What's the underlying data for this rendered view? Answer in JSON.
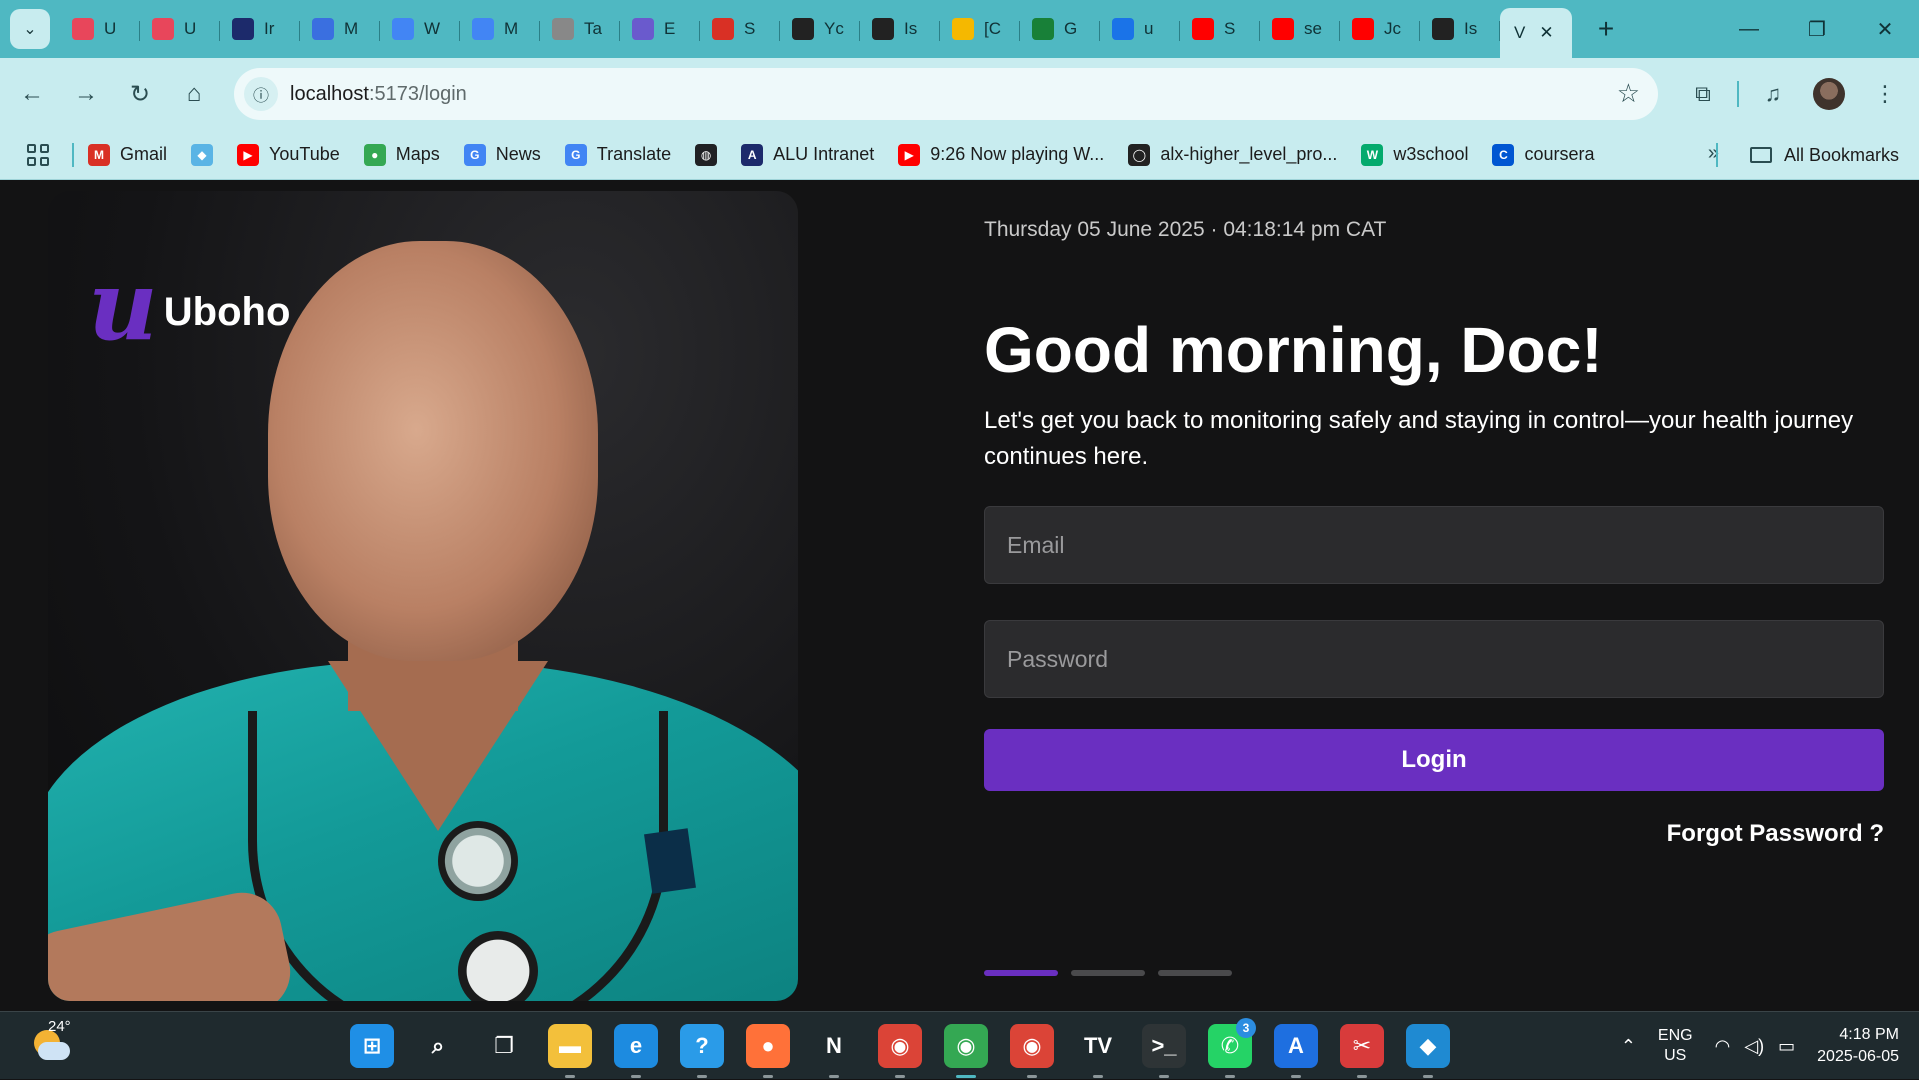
{
  "browser": {
    "tabs": [
      {
        "letter": "U",
        "color": "#e8465b"
      },
      {
        "letter": "U",
        "color": "#e8465b"
      },
      {
        "letter": "Ir",
        "color": "#1c2a6b"
      },
      {
        "letter": "M",
        "color": "#3a6fe0"
      },
      {
        "letter": "W",
        "color": "#4285f4"
      },
      {
        "letter": "M",
        "color": "#4285f4"
      },
      {
        "letter": "Ta",
        "color": "#888888"
      },
      {
        "letter": "E",
        "color": "#6a5acd"
      },
      {
        "letter": "S",
        "color": "#d93025"
      },
      {
        "letter": "Yc",
        "color": "#222222"
      },
      {
        "letter": "Is",
        "color": "#222222"
      },
      {
        "letter": "[C",
        "color": "#f5b800"
      },
      {
        "letter": "G",
        "color": "#188038"
      },
      {
        "letter": "u",
        "color": "#1a73e8"
      },
      {
        "letter": "S",
        "color": "#ff0000"
      },
      {
        "letter": "se",
        "color": "#ff0000"
      },
      {
        "letter": "Jc",
        "color": "#ff0000"
      },
      {
        "letter": "Is",
        "color": "#222222"
      }
    ],
    "active_tab_letter": "V",
    "active_tab_close": "✕",
    "new_tab": "+",
    "window": {
      "minimize": "—",
      "restore": "❐",
      "close": "✕"
    },
    "nav": {
      "back": "←",
      "forward": "→",
      "reload": "↻",
      "home": "⌂"
    },
    "url_host": "localhost",
    "url_path": ":5173/login",
    "bookmarks": [
      {
        "label": "Gmail",
        "icon": "gmail-icon",
        "color": "#d93025",
        "glyph": "M"
      },
      {
        "label": "",
        "icon": "cube-icon",
        "color": "#5ab4e5",
        "glyph": "◆"
      },
      {
        "label": "YouTube",
        "icon": "youtube-icon",
        "color": "#ff0000",
        "glyph": "▶"
      },
      {
        "label": "Maps",
        "icon": "maps-pin-icon",
        "color": "#34a853",
        "glyph": "●"
      },
      {
        "label": "News",
        "icon": "news-icon",
        "color": "#4285f4",
        "glyph": "G"
      },
      {
        "label": "Translate",
        "icon": "translate-icon",
        "color": "#4285f4",
        "glyph": "G"
      },
      {
        "label": "",
        "icon": "globe-icon",
        "color": "#202124",
        "glyph": "◍"
      },
      {
        "label": "ALU Intranet",
        "icon": "alu-icon",
        "color": "#1c2a6b",
        "glyph": "A"
      },
      {
        "label": "9:26 Now playing W...",
        "icon": "youtube-icon",
        "color": "#ff0000",
        "glyph": "▶"
      },
      {
        "label": "alx-higher_level_pro...",
        "icon": "github-icon",
        "color": "#222222",
        "glyph": "◯"
      },
      {
        "label": "w3school",
        "icon": "w3school-icon",
        "color": "#04aa6d",
        "glyph": "W"
      },
      {
        "label": "coursera",
        "icon": "coursera-icon",
        "color": "#0056d2",
        "glyph": "C"
      }
    ],
    "bookmarks_more": "»",
    "all_bookmarks": "All Bookmarks"
  },
  "page": {
    "logo_mark": "u",
    "logo_text": "Uboho",
    "datetime": "Thursday 05 June 2025 · 04:18:14 pm CAT",
    "greeting": "Good morning, Doc!",
    "subtitle": "Let's get you back to monitoring safely and staying in control—your health journey continues here.",
    "email_placeholder": "Email",
    "password_placeholder": "Password",
    "login_label": "Login",
    "forgot_label": "Forgot Password ?",
    "carousel_active_index": 0,
    "accent": "#6a2fc1"
  },
  "taskbar": {
    "temperature": "24°",
    "apps": [
      {
        "name": "windows-start",
        "glyph": "⊞",
        "color": "#1f8fe6"
      },
      {
        "name": "search",
        "glyph": "⌕",
        "color": "transparent"
      },
      {
        "name": "task-view",
        "glyph": "❐",
        "color": "transparent"
      },
      {
        "name": "file-explorer",
        "glyph": "▬",
        "color": "#f3c03b"
      },
      {
        "name": "edge",
        "glyph": "e",
        "color": "#1d8be0"
      },
      {
        "name": "help",
        "glyph": "?",
        "color": "#2a9be8"
      },
      {
        "name": "firefox",
        "glyph": "●",
        "color": "#ff7139"
      },
      {
        "name": "netflix",
        "glyph": "N",
        "color": "transparent"
      },
      {
        "name": "chrome",
        "glyph": "◉",
        "color": "#db4437"
      },
      {
        "name": "chrome-active",
        "glyph": "◉",
        "color": "#34a853"
      },
      {
        "name": "chrome-profile",
        "glyph": "◉",
        "color": "#db4437"
      },
      {
        "name": "tradingview",
        "glyph": "TV",
        "color": "transparent"
      },
      {
        "name": "terminal",
        "glyph": ">_",
        "color": "#2e3436"
      },
      {
        "name": "whatsapp",
        "glyph": "✆",
        "color": "#25d366",
        "badge": "3"
      },
      {
        "name": "app-store",
        "glyph": "A",
        "color": "#1e6fe0"
      },
      {
        "name": "snipping-tool",
        "glyph": "✂",
        "color": "#d83b3b"
      },
      {
        "name": "vscode",
        "glyph": "◆",
        "color": "#1f8ad2"
      }
    ],
    "lang_top": "ENG",
    "lang_bottom": "US",
    "time": "4:18 PM",
    "date": "2025-06-05"
  }
}
